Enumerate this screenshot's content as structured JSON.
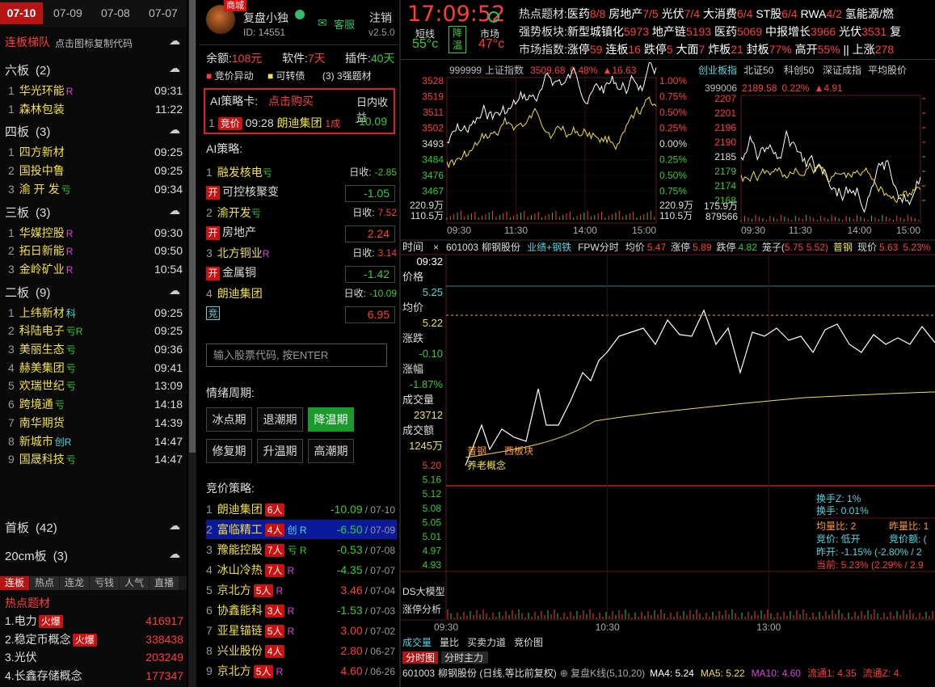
{
  "date_tabs": [
    "07-10",
    "07-09",
    "07-08",
    "07-07"
  ],
  "ladder": {
    "title": "连板梯队",
    "hint": "点击图标复制代码"
  },
  "groups": [
    {
      "label": "六板",
      "count": "(2)",
      "items": [
        {
          "n": "1",
          "name": "华光环能",
          "tag": "R",
          "tagc": "rtag",
          "time": "09:31"
        },
        {
          "n": "1",
          "name": "森林包装",
          "tag": "",
          "tagc": "",
          "time": "11:22"
        }
      ]
    },
    {
      "label": "四板",
      "count": "(3)",
      "items": [
        {
          "n": "1",
          "name": "四方新材",
          "tag": "",
          "tagc": "",
          "time": "09:25"
        },
        {
          "n": "2",
          "name": "国投中鲁",
          "tag": "",
          "tagc": "",
          "time": "09:25"
        },
        {
          "n": "3",
          "name": "渝 开 发",
          "tag": "亏",
          "tagc": "gtag",
          "time": "09:34"
        }
      ]
    },
    {
      "label": "三板",
      "count": "(3)",
      "items": [
        {
          "n": "1",
          "name": "华媒控股",
          "tag": "R",
          "tagc": "rtag",
          "time": "09:30"
        },
        {
          "n": "2",
          "name": "拓日新能",
          "tag": "R",
          "tagc": "rtag",
          "time": "09:50"
        },
        {
          "n": "3",
          "name": "金岭矿业",
          "tag": "R",
          "tagc": "rtag",
          "time": "10:54"
        }
      ]
    },
    {
      "label": "二板",
      "count": "(9)",
      "items": [
        {
          "n": "1",
          "name": "上纬新材",
          "tag": "科",
          "tagc": "ctag",
          "time": "09:25"
        },
        {
          "n": "2",
          "name": "科陆电子",
          "tag": "亏R",
          "tagc": "gtag",
          "time": "09:25"
        },
        {
          "n": "3",
          "name": "美丽生态",
          "tag": "亏",
          "tagc": "gtag",
          "time": "09:36"
        },
        {
          "n": "4",
          "name": "赫美集团",
          "tag": "亏",
          "tagc": "gtag",
          "time": "09:41"
        },
        {
          "n": "5",
          "name": "欢瑞世纪",
          "tag": "亏",
          "tagc": "gtag",
          "time": "13:09"
        },
        {
          "n": "6",
          "name": "跨境通",
          "tag": "亏",
          "tagc": "gtag",
          "time": "14:18"
        },
        {
          "n": "7",
          "name": "南华期货",
          "tag": "",
          "tagc": "",
          "time": "14:39"
        },
        {
          "n": "8",
          "name": "新城市",
          "tag": "创R",
          "tagc": "ctag",
          "time": "14:47"
        },
        {
          "n": "9",
          "name": "国晟科技",
          "tag": "亏",
          "tagc": "gtag",
          "time": "14:47"
        }
      ]
    }
  ],
  "first_board": {
    "label": "首板",
    "count": "(42)"
  },
  "cm20": {
    "label": "20cm板",
    "count": "(3)"
  },
  "bottom_tabs": [
    "连板",
    "热点",
    "连龙",
    "亏钱",
    "人气",
    "直播"
  ],
  "hot_title": "热点题材",
  "hot": [
    {
      "n": "1.",
      "name": "电力",
      "tag": "火爆",
      "val": "416917"
    },
    {
      "n": "2.",
      "name": "稳定币概念",
      "tag": "火爆",
      "val": "338438"
    },
    {
      "n": "3.",
      "name": "光伏",
      "tag": "",
      "val": "203249"
    },
    {
      "n": "4.",
      "name": "长鑫存储概念",
      "tag": "",
      "val": "177347"
    }
  ],
  "user": {
    "name": "复盘小独",
    "id": "ID: 14551",
    "badge": "商城",
    "service": "客服",
    "logout": "注销",
    "version": "v2.5.0"
  },
  "account": {
    "balance_label": "余额:",
    "balance": "108元",
    "soft_label": "软件:",
    "soft": "7天",
    "plugin_label": "插件:",
    "plugin": "40天"
  },
  "legend": {
    "a": "竞价异动",
    "b": "可转债",
    "c": "(3) 3强题材"
  },
  "ai_card": {
    "title": "AI策略卡:",
    "buy": "点击购买",
    "col": "日内收益",
    "row": {
      "n": "1",
      "tag": "竞价",
      "time": "09:28",
      "name": "朗迪集团",
      "count": "1成",
      "val": "-10.09"
    }
  },
  "ai_strategy_title": "AI策略:",
  "ai_items": [
    {
      "n": "1",
      "name": "融发核电",
      "tag": "亏",
      "rl": "日收:",
      "rv": "-2.85",
      "rvc": "green",
      "sub": "可控核聚变",
      "box": "-1.05",
      "boxc": "green",
      "pre": "开"
    },
    {
      "n": "2",
      "name": "渝开发",
      "tag": "亏",
      "rl": "日收:",
      "rv": "7.52",
      "rvc": "red",
      "sub": "房地产",
      "box": "2.24",
      "boxc": "red",
      "pre": "开"
    },
    {
      "n": "3",
      "name": "北方铜业",
      "tag": "R",
      "rl": "日收:",
      "rv": "3.14",
      "rvc": "red",
      "sub": "金属铜",
      "box": "-1.42",
      "boxc": "green",
      "pre": "开"
    },
    {
      "n": "4",
      "name": "朗迪集团",
      "tag": "",
      "rl": "日收:",
      "rv": "-10.09",
      "rvc": "green",
      "sub": "",
      "box": "6.95",
      "boxc": "red",
      "pre": "竞"
    }
  ],
  "search_placeholder": "输入股票代码, 按ENTER",
  "cycle_title": "情绪周期:",
  "cycle_buttons": [
    "冰点期",
    "退潮期",
    "降温期",
    "修复期",
    "升温期",
    "高潮期"
  ],
  "bid_title": "竞价策略:",
  "bid": [
    {
      "n": "1",
      "name": "朗迪集团",
      "people": "6人",
      "tag": "",
      "val": "-10.09",
      "date": "/ 07-10"
    },
    {
      "n": "2",
      "name": "富临精工",
      "people": "4人",
      "tag": "创 R",
      "val": "-6.50",
      "date": "/ 07-09"
    },
    {
      "n": "3",
      "name": "豫能控股",
      "people": "7人",
      "tag": "亏 R",
      "val": "-0.53",
      "date": "/ 07-08"
    },
    {
      "n": "4",
      "name": "冰山冷热",
      "people": "7人",
      "tag": "R",
      "val": "-4.35",
      "date": "/ 07-07"
    },
    {
      "n": "5",
      "name": "京北方",
      "people": "5人",
      "tag": "R",
      "val": "3.46",
      "date": "/ 07-04"
    },
    {
      "n": "6",
      "name": "协鑫能科",
      "people": "3人",
      "tag": "R",
      "val": "-1.53",
      "date": "/ 07-03"
    },
    {
      "n": "7",
      "name": "亚星锚链",
      "people": "5人",
      "tag": "R",
      "val": "3.00",
      "date": "/ 07-02"
    },
    {
      "n": "8",
      "name": "兴业股份",
      "people": "4人",
      "tag": "",
      "val": "2.80",
      "date": "/ 06-27"
    },
    {
      "n": "9",
      "name": "京北方",
      "people": "5人",
      "tag": "R",
      "val": "4.60",
      "date": "/ 06-26"
    }
  ],
  "clock": {
    "time": "17:09:52",
    "l1": "短线",
    "t1": "55°c",
    "l2": "降温",
    "l3": "市场",
    "t3": "47°c"
  },
  "hot_topics": {
    "label": "热点题材:",
    "text": "医药8/8  房地产7/5  光伏7/4  大消费6/4  ST股6/4  RWA4/2  氢能源/燃"
  },
  "strong": {
    "label": "强势板块:",
    "text": "新型城镇化5973  地产链5193  医药5069  中报增长3966  光伏3531  复"
  },
  "market": {
    "label": "市场指数:",
    "text": "涨停59  连板16  跌停5  大面7  炸板21  封板77%  高开55%  ||  上涨278"
  },
  "idx1": {
    "code": "999999",
    "name": "上证指数",
    "price": "3509.68",
    "pct": "0.48%",
    "chg": "▲16.63",
    "y_left": [
      "3528",
      "3519",
      "3511",
      "3502",
      "3493",
      "3484",
      "3476",
      "3467"
    ],
    "y_right": [
      "1.00%",
      "0.75%",
      "0.50%",
      "0.25%",
      "0.00%",
      "0.25%",
      "0.50%",
      "0.75%"
    ],
    "vol1": "220.9万",
    "vol2": "110.5万",
    "times": [
      "09:30",
      "11:30",
      "14:00",
      "15:00"
    ]
  },
  "idx_tabs": [
    "创业板指",
    "北证50",
    "科创50",
    "深证成指",
    "平均股价"
  ],
  "idx2": {
    "code": "399006",
    "price": "2189.58",
    "pct": "0.22%",
    "chg": "▲4.91",
    "y_left": [
      "2207",
      "2201",
      "2196",
      "2190",
      "2185",
      "2179",
      "2174",
      "2168"
    ],
    "vol1": "175.9万",
    "vol2": "879566",
    "times": [
      "09:30",
      "11:30",
      "14:00",
      "15:00"
    ]
  },
  "stock": {
    "code": "601003",
    "name": "柳钢股份",
    "concept": "业绩+钢铁",
    "fpw": "FPW分时",
    "avg_l": "均价",
    "avg": "5.47",
    "zf_l": "涨停",
    "zf": "5.89",
    "df_l": "跌停",
    "df": "4.82",
    "cage_l": "笼子(",
    "cage": "5.75 5.52)",
    "pj": "普钢",
    "now_l": "现价",
    "now": "5.63",
    "pct": "5.23%"
  },
  "left_info": {
    "time_l": "时间",
    "time": "09:32",
    "price_l": "价格",
    "price": "5.25",
    "avg_l": "均价",
    "avg": "5.22",
    "chg_l": "涨跌",
    "chg": "-0.10",
    "amp_l": "涨幅",
    "amp": "-1.87%",
    "vol_l": "成交量",
    "vol": "23712",
    "amt_l": "成交额",
    "amt": "1245万"
  },
  "y_axis": [
    "5.20",
    "5.16",
    "5.12",
    "5.08",
    "5.05",
    "5.01",
    "4.97",
    "4.93"
  ],
  "annot": {
    "a": "普钢",
    "b": "西板块",
    "c": "养老概念"
  },
  "stats": {
    "hs_z": "换手Z:  1%",
    "hs": "换手:  0.01%",
    "jlb": "均量比:  2",
    "zlb": "昨量比:  1",
    "jj": "竞价:  低开",
    "jje": "竞价额:  (",
    "zk": "昨开:  -1.15%  (-2.80% / 2",
    "dq": "当前:  5.23%  (2.29% / 2.9"
  },
  "sub_labels": {
    "a": "DS大模型",
    "b": "涨停分析"
  },
  "bottom_times": [
    "09:30",
    "10:30",
    "13:00"
  ],
  "bottom_tabs1": [
    "成交量",
    "量比",
    "买卖力道",
    "竞价图"
  ],
  "bottom_tabs2": [
    "分时图",
    "分时主力"
  ],
  "kline": {
    "code": "601003",
    "name": "柳钢股份 (日线,等比前复权)",
    "fp": "复盘K线(5,10,20)",
    "ma4": "MA4: 5.24",
    "ma5": "MA5: 5.22",
    "ma10": "MA10: 4.60",
    "lt1": "流通1: 4.35",
    "lt2": "流通Z: 4."
  },
  "colors": {
    "red": "#ff3b3b",
    "green": "#33cc33",
    "yellow": "#f0e040",
    "cyan": "#4dd8e0"
  }
}
